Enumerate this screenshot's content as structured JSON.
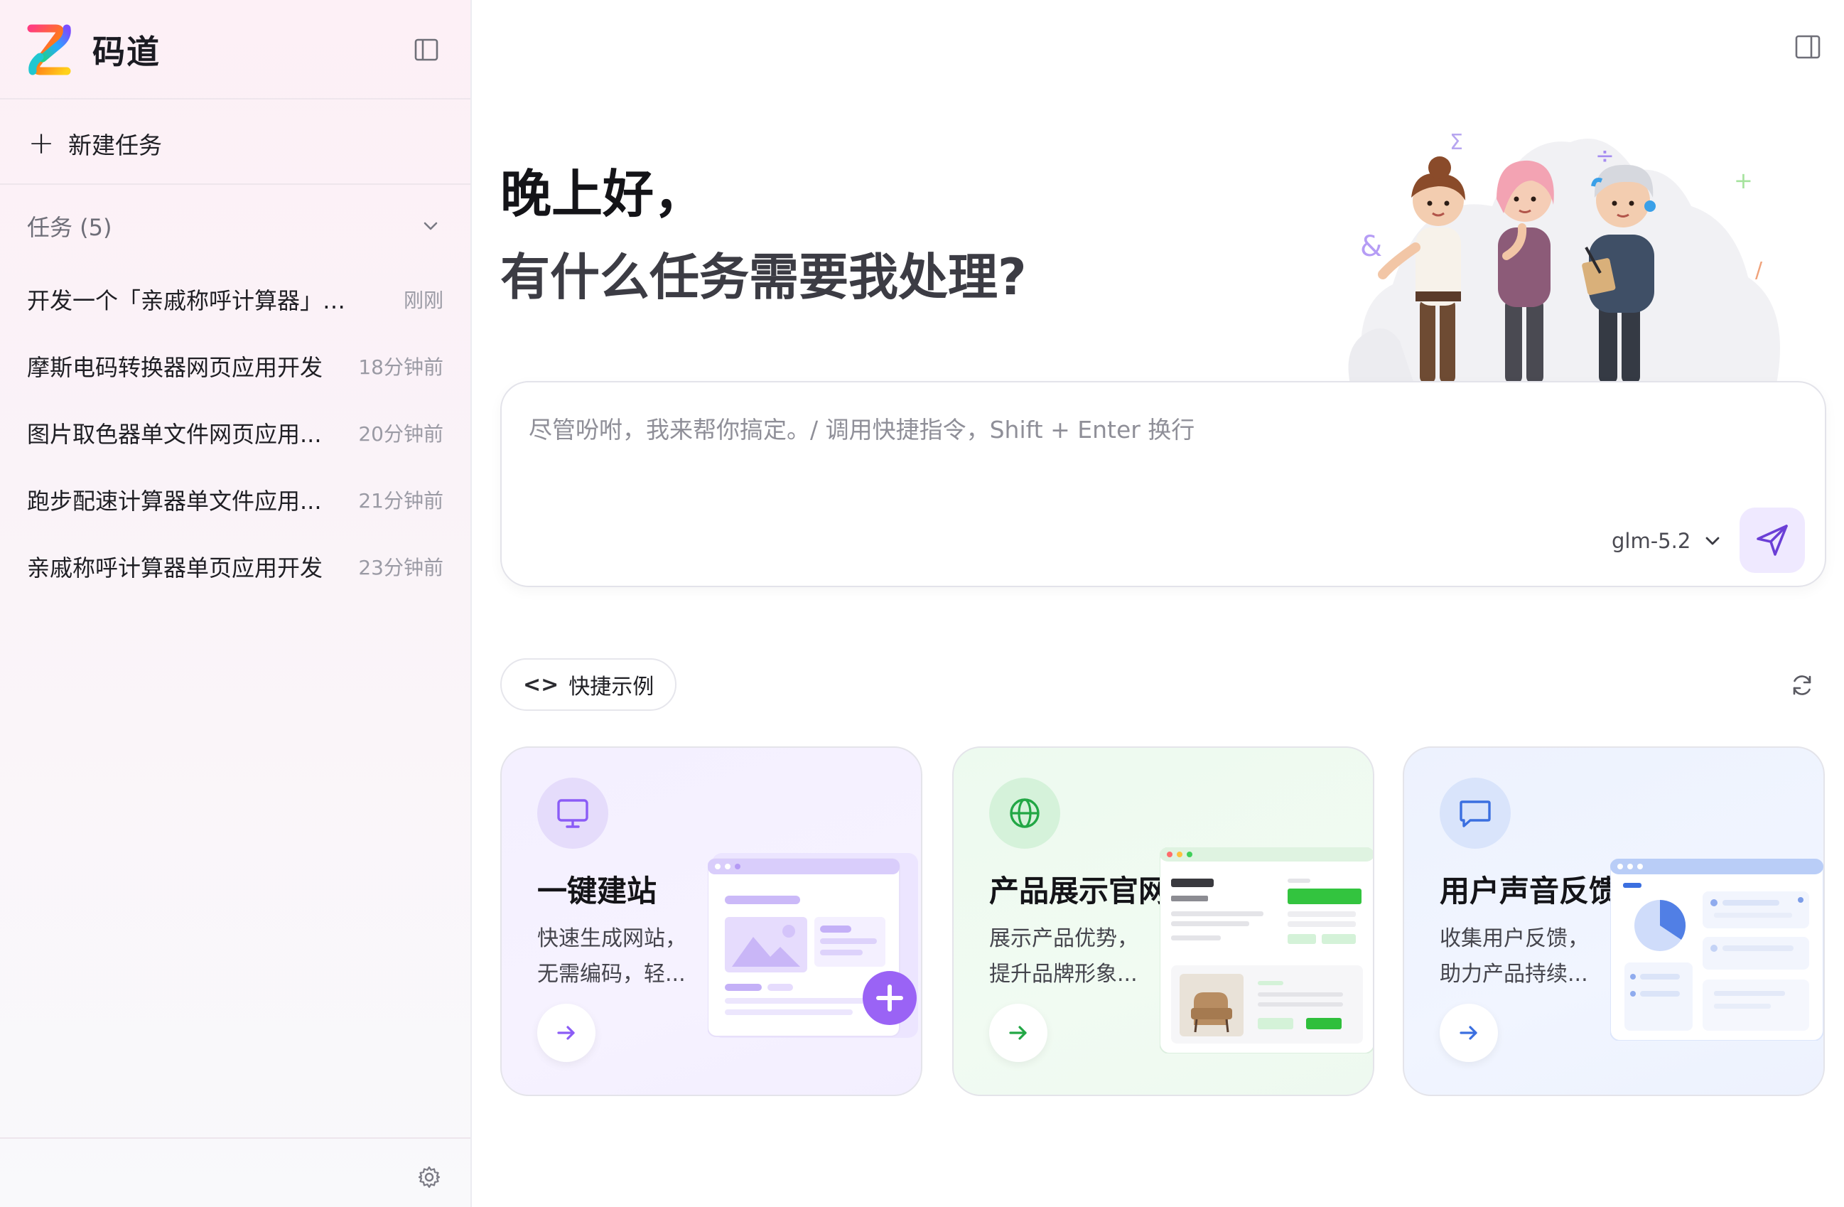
{
  "brand": {
    "name": "码道"
  },
  "sidebar": {
    "new_task_label": "新建任务",
    "tasks_header": "任务 (5)",
    "tasks": [
      {
        "name": "开发一个「亲戚称呼计算器」单...",
        "time": "刚刚"
      },
      {
        "name": "摩斯电码转换器网页应用开发",
        "time": "18分钟前"
      },
      {
        "name": "图片取色器单文件网页应用...",
        "time": "20分钟前"
      },
      {
        "name": "跑步配速计算器单文件应用...",
        "time": "21分钟前"
      },
      {
        "name": "亲戚称呼计算器单页应用开发",
        "time": "23分钟前"
      }
    ]
  },
  "main": {
    "greeting": "晚上好，",
    "question": "有什么任务需要我处理?",
    "composer": {
      "placeholder": "尽管吩咐，我来帮你搞定。/ 调用快捷指令，Shift + Enter 换行",
      "model": "glm-5.2"
    },
    "quick_examples": {
      "code_symbol": "<>",
      "label": "快捷示例"
    },
    "cards": [
      {
        "title": "一键建站",
        "desc": "快速生成网站，无需编码，轻...",
        "accent": "#8b5cf6"
      },
      {
        "title": "产品展示官网",
        "desc": "展示产品优势，提升品牌形象...",
        "accent": "#22a745"
      },
      {
        "title": "用户声音反馈",
        "desc": "收集用户反馈，助力产品持续...",
        "accent": "#3b6fe0"
      }
    ]
  },
  "colors": {
    "sidebar_bg": "#fdf0f6",
    "send_bg": "#efe9ff",
    "send_icon": "#6b3fd6",
    "purple": "#8b5cf6",
    "green": "#22a745",
    "blue": "#3b6fe0"
  },
  "icons": {
    "logo": "brand-logo",
    "collapse": "sidebar-collapse-icon",
    "plus": "plus-icon",
    "chevron": "chevron-down-icon",
    "settings": "gear-icon",
    "panel": "right-panel-icon",
    "send": "send-icon",
    "code": "code-icon",
    "refresh": "refresh-icon",
    "monitor": "monitor-icon",
    "globe": "globe-icon",
    "message": "message-icon",
    "arrow": "arrow-right-icon"
  }
}
